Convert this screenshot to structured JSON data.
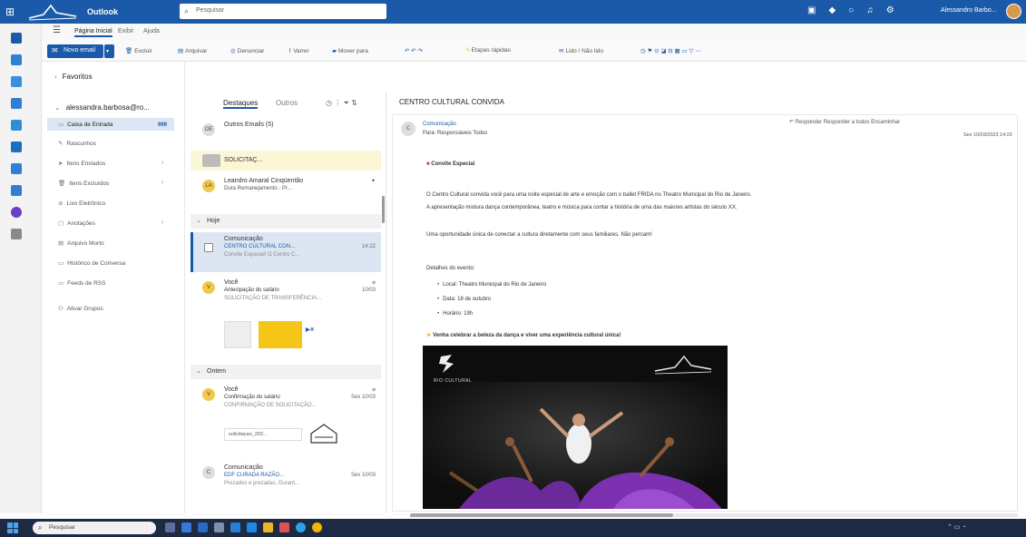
{
  "topbar": {
    "app_name": "Outlook",
    "search_placeholder": "Pesquisar",
    "user_name": "Alessandro Barbo..."
  },
  "tabs": [
    "Página Inicial",
    "Exibir",
    "Ajuda"
  ],
  "ribbon": {
    "new_mail": "Novo email",
    "buttons": [
      "Excluir",
      "Arquivar",
      "Denunciar",
      "Varrer",
      "Mover para",
      "Etapas rápidas",
      "Lido / Não lido"
    ]
  },
  "folders": {
    "favorites": "Favoritos",
    "account": "alessandra.barbosa@ro...",
    "items": [
      {
        "label": "Caixa de Entrada",
        "count": "999",
        "icon": "inbox-icon"
      },
      {
        "label": "Rascunhos",
        "count": "",
        "icon": "draft-icon"
      },
      {
        "label": "Itens Enviados",
        "count": "",
        "icon": "sent-icon"
      },
      {
        "label": "Itens Excluídos",
        "count": "",
        "icon": "trash-icon"
      },
      {
        "label": "Lixo Eletrônico",
        "count": "",
        "icon": "junk-icon"
      },
      {
        "label": "Anotações",
        "count": "",
        "icon": "notes-icon"
      },
      {
        "label": "Arquivo Morto",
        "count": "",
        "icon": "archive-icon"
      },
      {
        "label": "Histórico de Conversa",
        "count": "",
        "icon": "history-icon"
      },
      {
        "label": "Feeds de RSS",
        "count": "",
        "icon": "rss-icon"
      }
    ],
    "add_group": "Ativar Grupos"
  },
  "message_list": {
    "tab_focused": "Destaques",
    "tab_other": "Outros",
    "messages": [
      {
        "sender": "Outros Emails (5)",
        "subject": "",
        "preview": "",
        "time": "",
        "avatar": "OE"
      },
      {
        "sender": "SOLICITAÇ...",
        "subject": "",
        "preview": "",
        "time": "",
        "avatar": ""
      },
      {
        "sender": "Leandro Amaral Cinqüentão",
        "subject": "Dura Remanejamento - Pr...",
        "preview": "",
        "time": "",
        "avatar": "LA"
      },
      {
        "sender": "Comunicação",
        "subject": "CENTRO CULTURAL CON...",
        "preview": "Convite Especial! O Centro C...",
        "time": "14:22",
        "avatar": "C"
      },
      {
        "sender": "Você",
        "subject": "Antecipação do salário",
        "preview": "SOLICITAÇÃO DE TRANSFERÊNCIA...",
        "time": "10/03",
        "avatar": "V"
      },
      {
        "sender": "Você",
        "subject": "Confirmação do salário",
        "preview": "CONFIRMAÇÃO DE SOLICITAÇÃO...",
        "time": "Sex 10/03",
        "avatar": "V"
      },
      {
        "sender": "Comunicação",
        "subject": "EDF CURADA RAZÃO...",
        "preview": "Prezados e prezadas, Durant...",
        "time": "Sex 10/03",
        "avatar": "C"
      }
    ],
    "group_today": "Hoje",
    "group_last_week": "Ontem",
    "attachment_1": "",
    "attachment_2": "solicitacao_202..."
  },
  "reading": {
    "subject": "CENTRO CULTURAL CONVIDA",
    "sender": "Comunicação",
    "to": "Para: Responsáveis Todos",
    "actions": "Responder  Responder a todos  Encaminhar",
    "date": "Sex 10/03/2023 14:22",
    "convite": "Convite Especial",
    "line1": "O Centro Cultural convida você para uma noite especial de arte e emoção com o ballet FRIDA no Theatro Municipal do Rio de Janeiro.",
    "line2": "A apresentação mistura dança contemporânea, teatro e música para contar a história de uma das maiores artistas do século XX.",
    "line3": "Uma oportunidade única de conectar a cultura diretamente com seus familiares. Não percam!",
    "details_title": "Detalhes do evento:",
    "bullets": [
      "Local: Theatro Municipal do Rio de Janeiro",
      "Data: 18 de outubro",
      "Horário: 19h"
    ],
    "closing": "Venha celebrar a beleza da dança e viver uma experiência cultural única!",
    "poster_label": "RIO CULTURAL"
  },
  "taskbar": {
    "search": "Pesquisar"
  },
  "colors": {
    "brand": "#1a5aa8",
    "taskbar": "#1d2a44"
  }
}
